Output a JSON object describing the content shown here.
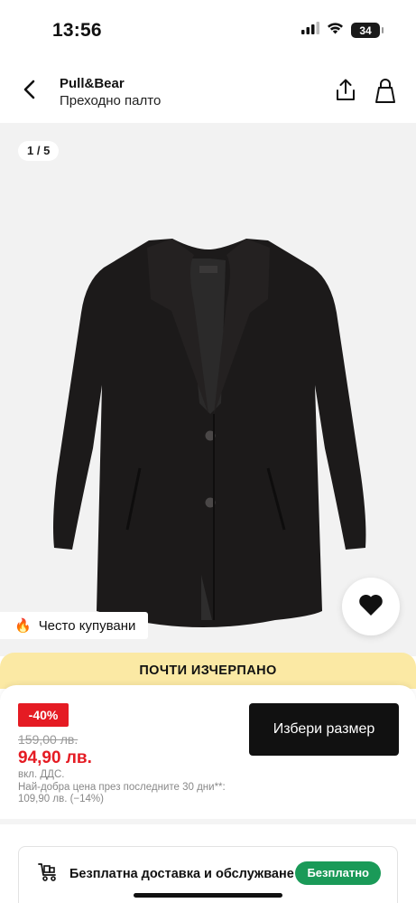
{
  "status_bar": {
    "time": "13:56",
    "battery": "34",
    "icons": [
      "signal-icon",
      "wifi-icon",
      "battery-icon"
    ]
  },
  "header": {
    "brand": "Pull&Bear",
    "title": "Преходно палто",
    "icons": [
      "back-arrow-icon",
      "share-icon",
      "shopping-bag-icon"
    ]
  },
  "gallery": {
    "counter": "1 / 5",
    "popular_icon": "🔥",
    "popular_label": "Често купувани",
    "icons": [
      "heart-icon"
    ],
    "image": "black-wool-coat-product-photo"
  },
  "stock_banner": {
    "text": "ПОЧТИ ИЗЧЕРПАНО"
  },
  "price": {
    "discount": "-40%",
    "old_price": "159,00 лв.",
    "new_price": "94,90 лв.",
    "vat_note": "вкл. ДДС.",
    "best_price_note": "Най-добра цена през последните 30 дни**: 109,90 лв. (−14%)",
    "select_size_label": "Избери размер"
  },
  "delivery": {
    "label": "Безплатна доставка и обслужване",
    "badge": "Безплатно",
    "icon": "delivery-truck-icon"
  },
  "colors": {
    "accent_red": "#e51b23",
    "banner_yellow": "#fbe9a4",
    "free_green": "#1a9a58",
    "button_black": "#111111"
  }
}
